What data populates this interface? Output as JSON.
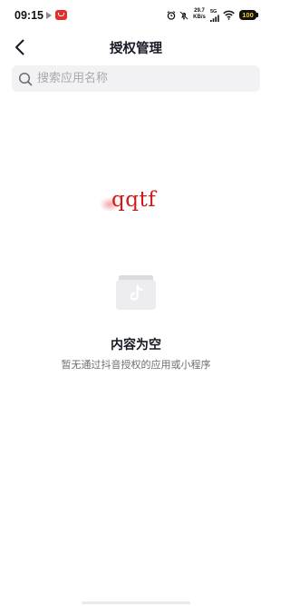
{
  "status_bar": {
    "time": "09:15",
    "speed_value": "29.7",
    "speed_unit": "KB/s",
    "network": "5G",
    "battery": "100"
  },
  "nav": {
    "title": "授权管理"
  },
  "search": {
    "placeholder": "搜索应用名称",
    "value": ""
  },
  "overlay": {
    "text": "qqtf",
    "color": "#d21a1a"
  },
  "empty_state": {
    "title": "内容为空",
    "description": "暂无通过抖音授权的应用或小程序",
    "icon": "folder-tiktok-icon"
  }
}
